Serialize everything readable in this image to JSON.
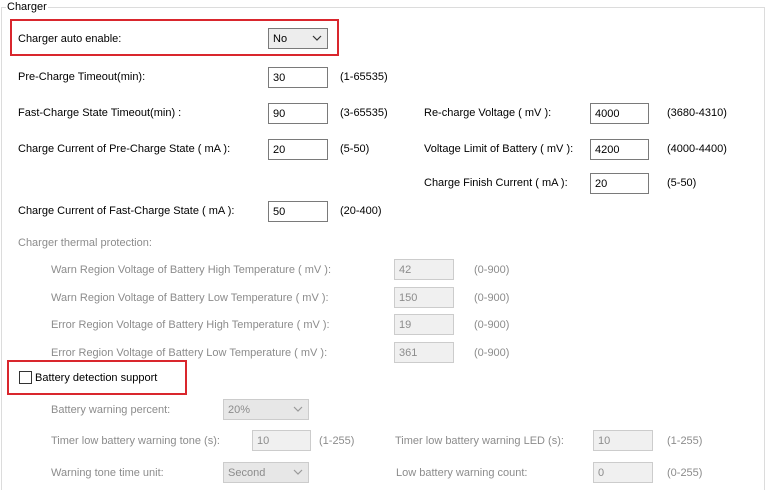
{
  "group_title": "Charger",
  "charger_auto_enable": {
    "label": "Charger auto enable:",
    "value": "No"
  },
  "pre_charge_timeout": {
    "label": "Pre-Charge Timeout(min):",
    "value": "30",
    "range": "(1-65535)"
  },
  "fast_charge_timeout": {
    "label": "Fast-Charge State Timeout(min) :",
    "value": "90",
    "range": "(3-65535)"
  },
  "pre_charge_current": {
    "label": "Charge Current of Pre-Charge State ( mA ):",
    "value": "20",
    "range": "(5-50)"
  },
  "fast_charge_current": {
    "label": "Charge Current of Fast-Charge State ( mA ):",
    "value": "50",
    "range": "(20-400)"
  },
  "recharge_voltage": {
    "label": "Re-charge Voltage ( mV ):",
    "value": "4000",
    "range": "(3680-4310)"
  },
  "voltage_limit": {
    "label": "Voltage Limit of Battery ( mV ):",
    "value": "4200",
    "range": "(4000-4400)"
  },
  "charge_finish_current": {
    "label": "Charge Finish Current ( mA ):",
    "value": "20",
    "range": "(5-50)"
  },
  "thermal": {
    "title": "Charger thermal protection:",
    "warn_high": {
      "label": "Warn Region Voltage of Battery High Temperature ( mV ):",
      "value": "42",
      "range": "(0-900)"
    },
    "warn_low": {
      "label": "Warn Region Voltage of Battery Low Temperature ( mV ):",
      "value": "150",
      "range": "(0-900)"
    },
    "error_high": {
      "label": "Error Region Voltage of Battery High Temperature ( mV ):",
      "value": "19",
      "range": "(0-900)"
    },
    "error_low": {
      "label": "Error Region Voltage of Battery Low Temperature ( mV ):",
      "value": "361",
      "range": "(0-900)"
    }
  },
  "battery_detection": {
    "label": "Battery detection support",
    "checked": false
  },
  "battery_warning_percent": {
    "label": "Battery warning percent:",
    "value": "20%"
  },
  "timer_low_battery_tone": {
    "label": "Timer low battery warning tone (s):",
    "value": "10",
    "range": "(1-255)"
  },
  "timer_low_battery_led": {
    "label": "Timer low battery warning LED (s):",
    "value": "10",
    "range": "(1-255)"
  },
  "warning_tone_time_unit": {
    "label": "Warning tone time unit:",
    "value": "Second"
  },
  "low_battery_warning_count": {
    "label": "Low battery warning count:",
    "value": "0",
    "range": "(0-255)"
  },
  "colors": {
    "highlight": "#d9262d",
    "disabled_text": "#8c8c8c",
    "frame": "#dcdcdc"
  }
}
